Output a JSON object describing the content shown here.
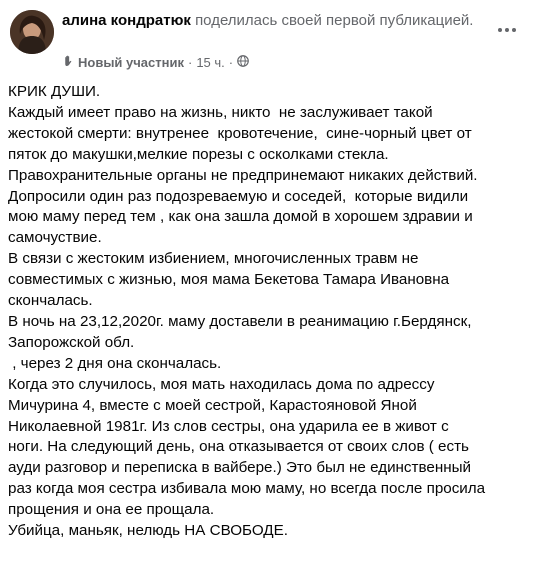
{
  "post": {
    "author": "алина кондратюк",
    "action": "поделилась своей первой публикацией.",
    "badge_icon": "wave-hand-icon",
    "badge_label": "Новый участник",
    "separator": "·",
    "time": "15 ч.",
    "privacy_icon": "globe-icon",
    "more_icon": "more-horizontal-icon",
    "lines": [
      "КРИК ДУШИ.",
      "Каждый имеет право на жизнь, никто  не заслуживает такой",
      "жестокой смерти: внутренее  кровотечение,  сине-чорный цвет от",
      "пяток до макушки,мелкие порезы с осколками стекла.",
      "Правохранительные органы не предпринемают никаких действий.",
      "Допросили один раз подозреваемую и соседей,  которые видили",
      "мою маму перед тем , как она зашла домой в хорошем здравии и",
      "самочуствие.",
      "В связи с жестоким избиением, многочисленных травм не",
      "совместимых с жизнью, моя мама Бекетова Тамара Ивановна",
      "скончалась.",
      "В ночь на 23,12,2020г. маму доставели в реанимацию г.Бердянск,",
      "Запорожской обл.",
      " , через 2 дня она скончалась.",
      "Когда это случилось, моя мать находилась дома по адрессу",
      "Мичурина 4, вместе с моей сестрой, Карастояновой Яной",
      "Николаевной 1981г. Из слов сестры, она ударила ее в живот с",
      "ноги. На следующий день, она отказывается от своих слов ( есть",
      "ауди разговор и переписка в вайбере.) Это был не единственный",
      "раз когда моя сестра избивала мою маму, но всегда после просила",
      "прощения и она ее прощала.",
      "Убийца, маньяк, нелюдь НА СВОБОДЕ."
    ]
  }
}
